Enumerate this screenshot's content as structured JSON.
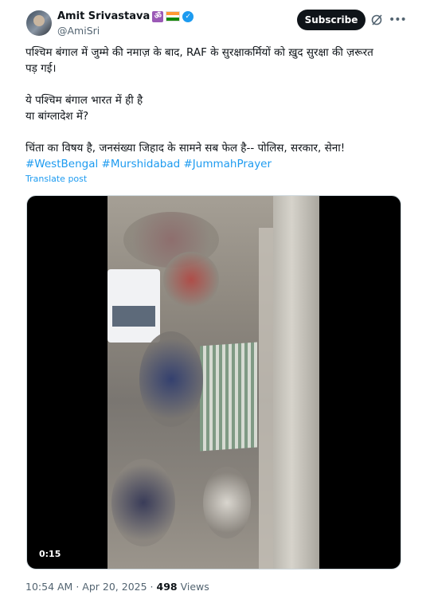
{
  "author": {
    "name": "Amit Srivastava",
    "handle": "@AmiSri"
  },
  "header": {
    "subscribe_label": "Subscribe"
  },
  "post": {
    "lines": [
      "पश्चिम बंगाल में जुम्मे की नमाज़ के बाद, RAF के सुरक्षाकर्मियों को ख़ुद सुरक्षा की ज़रूरत",
      "पड़ गई।",
      "ये पश्चिम बंगाल भारत में ही है",
      "या बांग्लादेश में?",
      "चिंता का विषय है, जनसंख्या जिहाद के सामने सब फेल है--  पोलिस, सरकार, सेना!"
    ],
    "hashtags": [
      "#WestBengal",
      "#Murshidabad",
      "#JummahPrayer"
    ],
    "translate_label": "Translate post"
  },
  "video": {
    "duration": "0:15"
  },
  "meta": {
    "time": "10:54 AM",
    "separator": "·",
    "date": "Apr 20, 2025",
    "views_count": "498",
    "views_label": "Views"
  },
  "icons": {
    "om": "om-badge-icon",
    "flag": "india-flag-icon",
    "verified": "verified-badge-icon",
    "grok": "grok-icon",
    "more": "more-options-icon"
  },
  "colors": {
    "accent": "#1d9bf0",
    "text": "#0f1419",
    "muted": "#536471"
  }
}
